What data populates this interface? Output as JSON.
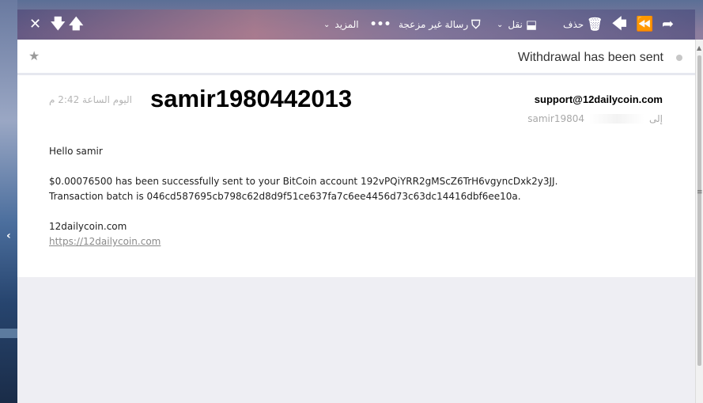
{
  "toolbar": {
    "close_icon": "close-icon",
    "down_icon": "arrow-down-icon",
    "up_icon": "arrow-up-icon",
    "more_label": "المزيد",
    "not_spam_label": "رسالة غير مزعجة",
    "move_label": "نقل",
    "delete_label": "حذف",
    "reply_icon": "reply-icon",
    "reply_all_icon": "reply-all-icon",
    "forward_icon": "forward-icon"
  },
  "message": {
    "subject": "Withdrawal has been sent",
    "date": "اليوم الساعة 2:42 م",
    "sender": "support@12dailycoin.com",
    "to_label": "إلى",
    "recipient": "samir19804",
    "overlay_username": "samir1980442013",
    "greeting": "Hello samir",
    "line1": "$0.00076500 has been successfully sent to your BitCoin account 192vPQiYRR2gMScZ6TrH6vgyncDxk2y3JJ.",
    "line2": "Transaction batch is 046cd587695cb798c62d8d9f51ce637fa7c6ee4456d73c63dc14416dbf6ee10a.",
    "signature": "12dailycoin.com",
    "link": "https://12dailycoin.com"
  }
}
